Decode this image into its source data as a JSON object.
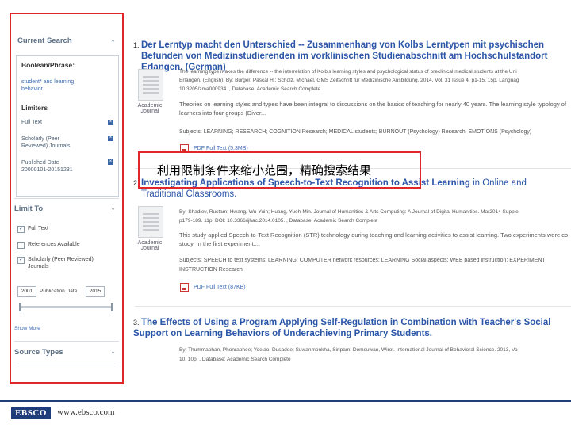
{
  "sidebar": {
    "current_search": {
      "heading": "Current Search",
      "boolean_label": "Boolean/Phrase:",
      "boolean_value": "student* and learning behavior",
      "limiters_label": "Limiters",
      "limiters": [
        {
          "label": "Full Text"
        },
        {
          "label": "Scholarly (Peer Reviewed) Journals"
        },
        {
          "label": "Published Date 20000101-20151231"
        }
      ]
    },
    "limit_to": {
      "heading": "Limit To",
      "options": [
        {
          "label": "Full Text",
          "checked": true
        },
        {
          "label": "References Available",
          "checked": false
        },
        {
          "label": "Scholarly (Peer Reviewed) Journals",
          "checked": true
        }
      ],
      "year_from": "2001",
      "pub_date_label": "Publication Date",
      "year_to": "2015",
      "show_more": "Show More"
    },
    "source_types": {
      "heading": "Source Types"
    }
  },
  "results": [
    {
      "number": "1.",
      "title": "Der Lerntyp macht den Unterschied -- Zusammenhang von Kolbs Lerntypen mit psychischen Befunden von Medizinstudierenden im vorklinischen Studienabschnitt am Hochschulstandort Erlangen. (German)",
      "meta1": "The learning type makes the difference -- the interrelation of Kolb's learning styles and psychological status of preclinical medical students at the Uni",
      "meta2": "Erlangen. (English). By: Burger, Pascal H.; Scholz, Michael. GMS Zeitschrift für Medizinische Ausbildung. 2014, Vol. 31 Issue 4, p1-15. 15p. Languag",
      "meta3": "10.3205/zma000934. , Database: Academic Search Complete",
      "abstract": "Theories on learning styles and types have been integral to discussions on the basics of teaching for nearly 40 years. The learning style typology of",
      "abstract2": "learners into four groups (Diver...",
      "thumb_label": "Academic Journal",
      "subjects": "Subjects: LEARNING; RESEARCH; COGNITION    Research; MEDICAL students; BURNOUT (Psychology)    Research; EMOTIONS (Psychology)",
      "pdf": "PDF Full Text (5.3MB)"
    },
    {
      "number": "2.",
      "title_hl": "Investigating Applications of Speech-to-Text Recognition to Assist Learning",
      "title_rest": " in Online and Traditional Classrooms.",
      "meta1": "By: Shadiev, Rustam; Hwang, Wu-Yuin; Huang, Yueh-Min. Journal of Humanities & Arts Computing: A Journal of Digital Humanities. Mar2014 Supple",
      "meta2": "p179-189. 11p. DOI: 10.3366/ijhac.2014.0105. , Database: Academic Search Complete",
      "abstract": "This study applied Speech-to-Text Recognition (STR) technology during teaching and learning activities to assist learning. Two experiments were co",
      "abstract2": "study. In the first experiment,...",
      "thumb_label": "Academic Journal",
      "subjects": "Subjects: SPEECH to text systems; LEARNING; COMPUTER network resources; LEARNING    Social aspects; WEB based instruction; EXPERIMENT",
      "subjects2": "INSTRUCTION    Research",
      "pdf": "PDF Full Text (87KB)"
    },
    {
      "number": "3.",
      "title": "The Effects of Using a Program Applying Self-Regulation in Combination with Teacher's Social Support on Learning Behaviors of Underachieving Primary Students.",
      "meta1": "By: Thummaphan, Phonraphee; Yoelao, Dusadee; Suwanmonkha, Siripam; Domsuwan, Wirot. International Journal of Behavioral Science. 2013, Vo",
      "meta2": "10. 10p. , Database: Academic Search Complete"
    }
  ],
  "annotation": "利用限制条件来缩小范围，精确搜索结果",
  "footer": {
    "logo": "EBSCO",
    "url": "www.ebsco.com"
  },
  "colors": {
    "accent": "#e0262b",
    "link": "#2b56a8",
    "brand": "#1f3d7a"
  }
}
